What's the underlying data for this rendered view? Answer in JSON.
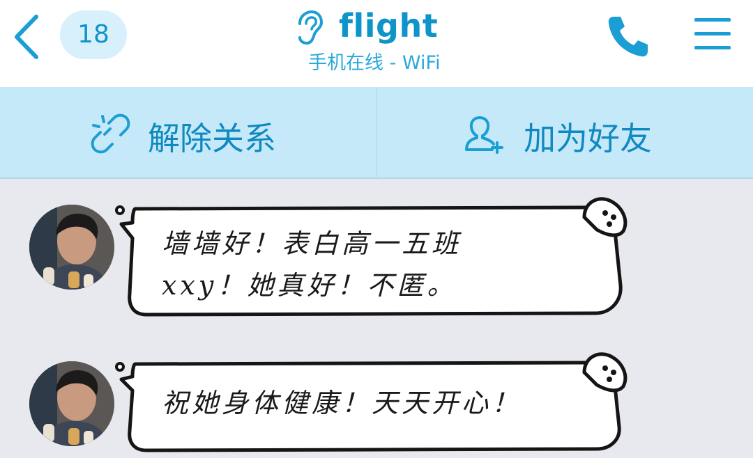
{
  "header": {
    "back_icon": "chevron-left-icon",
    "unread_count": "18",
    "ear_icon": "ear-icon",
    "title": "flight",
    "subtitle": "手机在线 - WiFi",
    "phone_icon": "phone-icon",
    "menu_icon": "hamburger-menu-icon",
    "accent_color": "#0d94c9"
  },
  "actions": {
    "unlink_label": "解除关系",
    "unlink_icon": "broken-link-icon",
    "add_friend_label": "加为好友",
    "add_friend_icon": "add-user-icon",
    "bar_color": "#c5e9f8"
  },
  "messages": [
    {
      "lines": [
        "墙墙好！表白高一五班",
        "xxy！她真好！不匿。"
      ]
    },
    {
      "lines": [
        "祝她身体健康！天天开心！"
      ]
    }
  ]
}
